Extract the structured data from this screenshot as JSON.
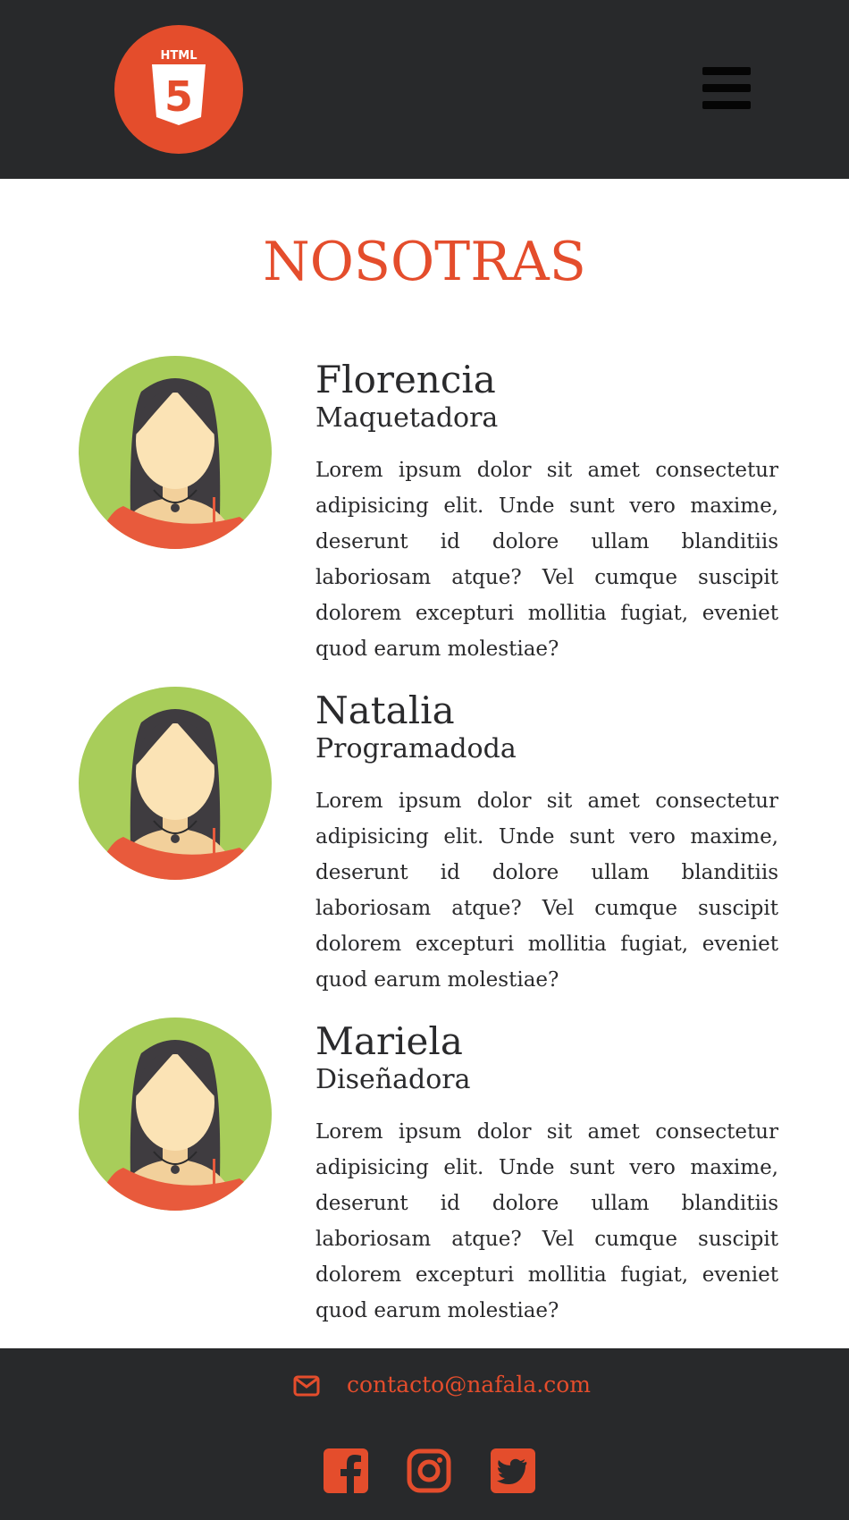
{
  "header": {
    "logo_icon": "html5-logo-icon",
    "logo_text": "HTML",
    "logo_numeral": "5",
    "menu_icon": "hamburger-menu-icon"
  },
  "page": {
    "title": "NOSOTRAS"
  },
  "members": [
    {
      "name": "Florencia",
      "role": "Maquetadora",
      "bio": "Lorem ipsum dolor sit amet consectetur adipisicing elit. Unde sunt vero maxime, deserunt id dolore ullam blanditiis laboriosam atque? Vel cumque suscipit dolorem excepturi mollitia fugiat, eveniet quod earum molestiae?",
      "avatar_icon": "woman-avatar-icon"
    },
    {
      "name": "Natalia",
      "role": "Programadoda",
      "bio": "Lorem ipsum dolor sit amet consectetur adipisicing elit. Unde sunt vero maxime, deserunt id dolore ullam blanditiis laboriosam atque? Vel cumque suscipit dolorem excepturi mollitia fugiat, eveniet quod earum molestiae?",
      "avatar_icon": "woman-avatar-icon"
    },
    {
      "name": "Mariela",
      "role": "Diseñadora",
      "bio": "Lorem ipsum dolor sit amet consectetur adipisicing elit. Unde sunt vero maxime, deserunt id dolore ullam blanditiis laboriosam atque? Vel cumque suscipit dolorem excepturi mollitia fugiat, eveniet quod earum molestiae?",
      "avatar_icon": "woman-avatar-icon"
    }
  ],
  "footer": {
    "email": "contacto@nafala.com",
    "email_icon": "envelope-icon",
    "social": [
      {
        "icon": "facebook-icon"
      },
      {
        "icon": "instagram-icon"
      },
      {
        "icon": "twitter-icon"
      }
    ]
  },
  "colors": {
    "accent": "#e44d2c",
    "dark": "#28292b",
    "text": "#2a2a2c",
    "avatar_bg": "#a8cd5a"
  }
}
